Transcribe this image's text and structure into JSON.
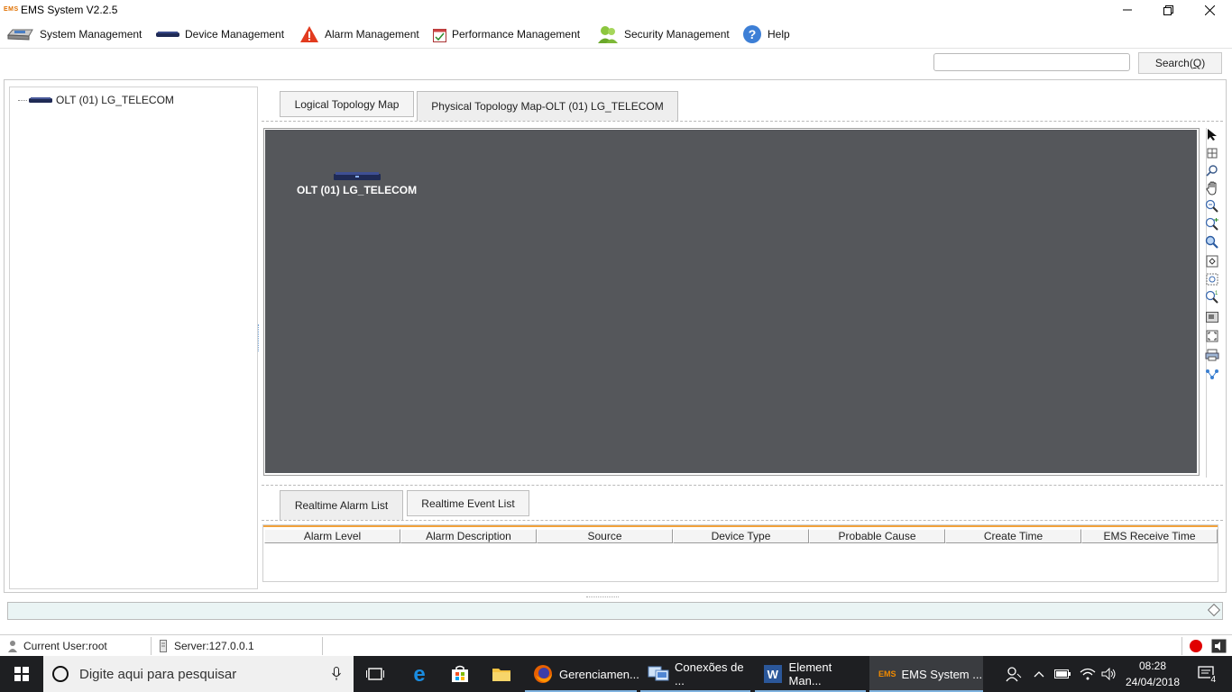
{
  "window": {
    "logo_text": "EMS",
    "title": "EMS System V2.2.5"
  },
  "menu": {
    "items": [
      {
        "label": "System Management",
        "icon": "system-management-icon"
      },
      {
        "label": "Device Management",
        "icon": "device-icon"
      },
      {
        "label": "Alarm Management",
        "icon": "alarm-warning-icon"
      },
      {
        "label": "Performance Management",
        "icon": "calendar-icon"
      },
      {
        "label": "Security Management",
        "icon": "users-icon"
      },
      {
        "label": "Help",
        "icon": "help-icon"
      }
    ]
  },
  "search": {
    "value": "",
    "placeholder": "",
    "button_label": "Search(",
    "button_accel": "Q",
    "button_suffix": ")"
  },
  "tree": {
    "root_label": "OLT (01) LG_TELECOM"
  },
  "topology": {
    "tabs": [
      {
        "label": "Logical Topology Map",
        "active": false
      },
      {
        "label": "Physical Topology Map-OLT (01) LG_TELECOM",
        "active": true
      }
    ],
    "canvas_color": "#55575b",
    "node_label": "OLT (01) LG_TELECOM"
  },
  "toolbar": {
    "tools": [
      "select-pointer-icon",
      "grid-icon",
      "search-icon",
      "pan-hand-icon",
      "zoom-out-icon",
      "zoom-in-icon",
      "zoom-region-icon",
      "fit-icon",
      "zoom-reset-icon",
      "zoom-custom-icon",
      "overview-icon",
      "fullscreen-icon",
      "print-icon",
      "layout-icon"
    ]
  },
  "alarms": {
    "tabs": [
      {
        "label": "Realtime Alarm List",
        "active": true
      },
      {
        "label": "Realtime Event List",
        "active": false
      }
    ],
    "columns": [
      "Alarm Level",
      "Alarm Description",
      "Source",
      "Device Type",
      "Probable Cause",
      "Create Time",
      "EMS Receive Time"
    ],
    "rows": []
  },
  "statusbar": {
    "current_user": "Current User:root",
    "server": "Server:127.0.0.1"
  },
  "taskbar": {
    "search_placeholder": "Digite aqui para pesquisar",
    "apps": [
      {
        "label": "Gerenciamen...",
        "icon": "firefox-icon"
      },
      {
        "label": "Conexões de ...",
        "icon": "network-connections-icon"
      },
      {
        "label": "Element Man...",
        "icon": "word-icon"
      },
      {
        "label": "EMS System ...",
        "icon": "ems-icon"
      }
    ],
    "time": "08:28",
    "date": "24/04/2018",
    "notification_count": "4",
    "ems_icon_text": "EMS",
    "word_icon_text": "W"
  }
}
